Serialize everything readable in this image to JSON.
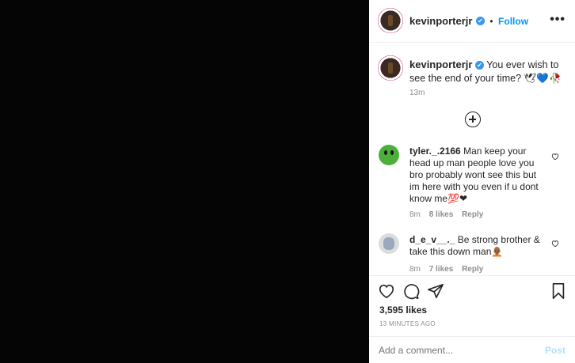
{
  "post": {
    "username": "kevinporterjr",
    "verified_mark": "✔",
    "separator": "•",
    "follow_label": "Follow",
    "more_icon": "more-options-icon"
  },
  "caption": {
    "username": "kevinporterjr",
    "text": "You ever wish to see the end of your time? 🕊💙🥀",
    "time": "13m"
  },
  "comments": [
    {
      "username": "tyler._.2166",
      "text": "Man keep your head up man people love you bro probably wont see this but im here with you even if u dont know me💯❤",
      "time": "8m",
      "likes": "8 likes",
      "reply": "Reply"
    },
    {
      "username": "d_e_v__._",
      "text": "Be strong brother & take this down man🧑🏾‍🦲",
      "time": "8m",
      "likes": "7 likes",
      "reply": "Reply"
    }
  ],
  "actions": {
    "likes": "3,595 likes",
    "timestamp": "13 MINUTES AGO"
  },
  "composer": {
    "placeholder": "Add a comment...",
    "post_label": "Post"
  },
  "colors": {
    "accent": "#0095f6",
    "verified": "#3897f0",
    "post_disabled": "#b2dffc"
  }
}
